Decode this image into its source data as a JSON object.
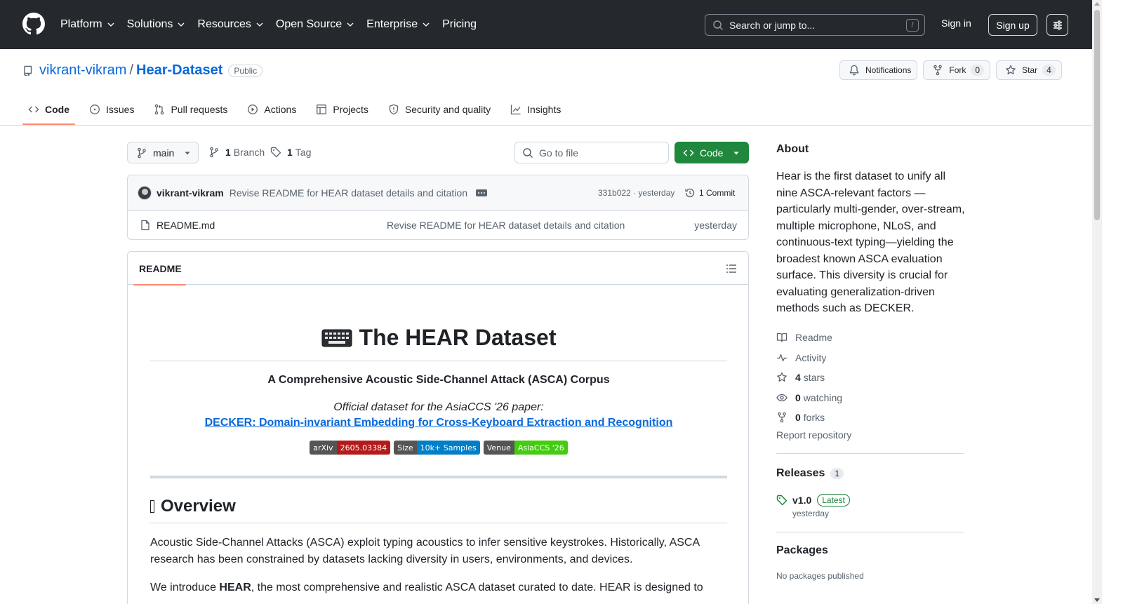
{
  "header": {
    "nav": [
      {
        "label": "Platform",
        "icon": "chevron-down-icon"
      },
      {
        "label": "Solutions",
        "icon": "chevron-down-icon"
      },
      {
        "label": "Resources",
        "icon": "chevron-down-icon"
      },
      {
        "label": "Open Source",
        "icon": "chevron-down-icon"
      },
      {
        "label": "Enterprise",
        "icon": "chevron-down-icon"
      },
      {
        "label": "Pricing"
      }
    ],
    "search_placeholder": "Search or jump to...",
    "search_shortcut": "/",
    "sign_in": "Sign in",
    "sign_up": "Sign up"
  },
  "repo": {
    "owner": "vikrant-vikram",
    "separator": "/",
    "name": "Hear-Dataset",
    "visibility": "Public",
    "notifications_label": "Notifications",
    "fork_label": "Fork",
    "fork_count": "0",
    "star_label": "Star",
    "star_count": "4"
  },
  "tabs": [
    {
      "label": "Code",
      "icon": "code-icon",
      "active": true
    },
    {
      "label": "Issues",
      "icon": "issue-icon"
    },
    {
      "label": "Pull requests",
      "icon": "pull-request-icon"
    },
    {
      "label": "Actions",
      "icon": "play-icon"
    },
    {
      "label": "Projects",
      "icon": "table-icon"
    },
    {
      "label": "Security and quality",
      "icon": "shield-icon"
    },
    {
      "label": "Insights",
      "icon": "graph-icon"
    }
  ],
  "toolbar": {
    "branch": "main",
    "branch_count": "1",
    "branch_label": "Branch",
    "tag_count": "1",
    "tag_label": "Tag",
    "goto_placeholder": "Go to file",
    "code_button": "Code"
  },
  "commit": {
    "author": "vikrant-vikram",
    "message": "Revise README for HEAR dataset details and citation",
    "hash_time": "331b022 · yesterday",
    "count_label": "1 Commit"
  },
  "files": [
    {
      "name": "README.md",
      "message": "Revise README for HEAR dataset details and citation",
      "time": "yesterday"
    }
  ],
  "readme": {
    "tab_label": "README",
    "title_icon": "⌨️",
    "title": "The HEAR Dataset",
    "subtitle": "A Comprehensive Acoustic Side-Channel Attack (ASCA) Corpus",
    "official": "Official dataset for the AsiaCCS '26 paper:",
    "paper_link": "DECKER: Domain-invariant Embedding for Cross-Keyboard Extraction and Recognition",
    "badges": [
      {
        "label": "arXiv",
        "value": "2605.03384",
        "color": "#b31b1b"
      },
      {
        "label": "Size",
        "value": "10k+ Samples",
        "color": "#007ec6"
      },
      {
        "label": "Venue",
        "value": "AsiaCCS '26",
        "color": "#4c1"
      }
    ],
    "overview_heading": "Overview",
    "overview_p1": "Acoustic Side-Channel Attacks (ASCA) exploit typing acoustics to infer sensitive keystrokes. Historically, ASCA research has been constrained by datasets lacking diversity in users, environments, and devices.",
    "overview_p2_pre": "We introduce ",
    "overview_p2_bold": "HEAR",
    "overview_p2_post": ", the most comprehensive and realistic ASCA dataset curated to date. HEAR is designed to"
  },
  "sidebar": {
    "about_title": "About",
    "about_desc": "Hear is the first dataset to unify all nine ASCA-relevant factors — particularly multi-gender, over-stream, multiple microphone, NLoS, and continuous-text typing—yielding the broadest known ASCA evaluation surface. This diversity is crucial for evaluating generalization-driven methods such as DECKER.",
    "readme": "Readme",
    "activity": "Activity",
    "stars_count": "4",
    "stars_label": "stars",
    "watching_count": "0",
    "watching_label": "watching",
    "forks_count": "0",
    "forks_label": "forks",
    "report": "Report repository",
    "releases_title": "Releases",
    "releases_count": "1",
    "release_name": "v1.0",
    "release_badge": "Latest",
    "release_date": "yesterday",
    "packages_title": "Packages",
    "no_packages": "No packages published"
  }
}
